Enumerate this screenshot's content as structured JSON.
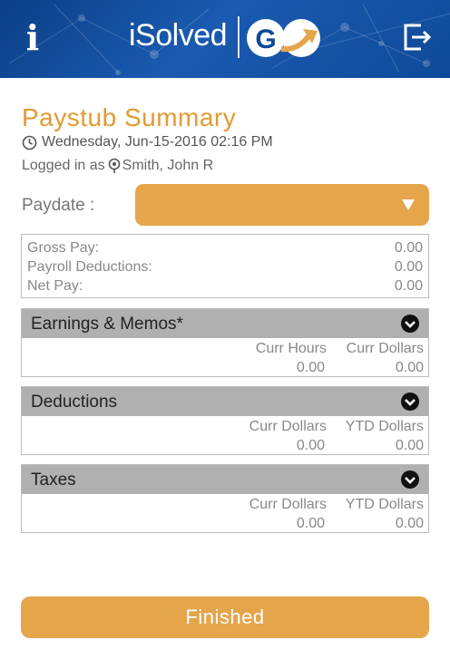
{
  "header": {
    "info_label": "i",
    "logo_text": "iSolved",
    "logo_go": "GO",
    "colors": {
      "header_bg": "#0e4a98",
      "accent": "#e5a54b",
      "title": "#e39a31"
    }
  },
  "page": {
    "title": "Paystub Summary",
    "datetime": "Wednesday, Jun-15-2016 02:16 PM",
    "logged_in_prefix": "Logged in as",
    "user_name": "Smith, John R"
  },
  "paydate": {
    "label": "Paydate :",
    "value": ""
  },
  "summary": [
    {
      "label": "Gross Pay:",
      "value": "0.00"
    },
    {
      "label": "Payroll Deductions:",
      "value": "0.00"
    },
    {
      "label": "Net Pay:",
      "value": "0.00"
    }
  ],
  "sections": [
    {
      "title": "Earnings & Memos*",
      "col1": "Curr Hours",
      "col2": "Curr Dollars",
      "val1": "0.00",
      "val2": "0.00"
    },
    {
      "title": "Deductions",
      "col1": "Curr Dollars",
      "col2": "YTD Dollars",
      "val1": "0.00",
      "val2": "0.00"
    },
    {
      "title": "Taxes",
      "col1": "Curr Dollars",
      "col2": "YTD Dollars",
      "val1": "0.00",
      "val2": "0.00"
    }
  ],
  "footer": {
    "finish_label": "Finished"
  }
}
